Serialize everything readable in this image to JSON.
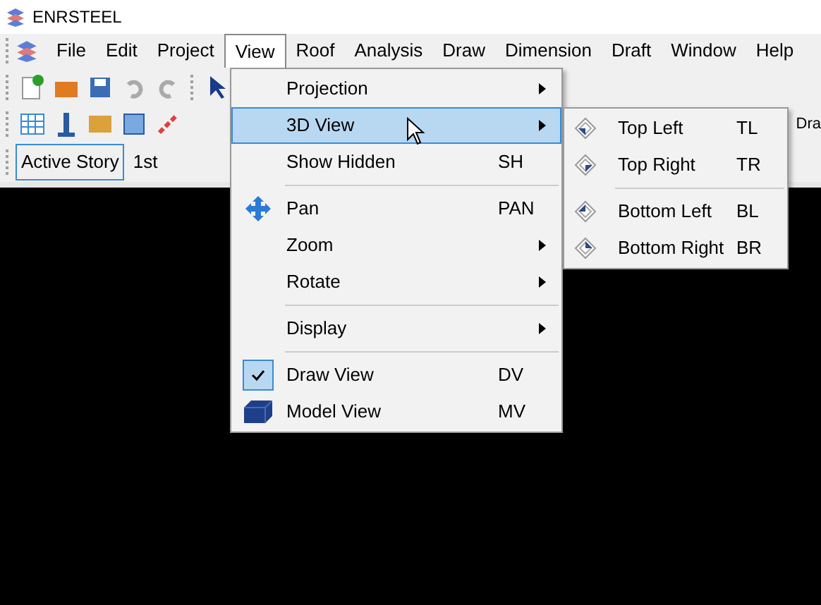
{
  "window": {
    "title": "ENRSTEEL"
  },
  "menubar": [
    {
      "label": "File",
      "selected": false
    },
    {
      "label": "Edit",
      "selected": false
    },
    {
      "label": "Project",
      "selected": false
    },
    {
      "label": "View",
      "selected": true
    },
    {
      "label": "Roof",
      "selected": false
    },
    {
      "label": "Analysis",
      "selected": false
    },
    {
      "label": "Draw",
      "selected": false
    },
    {
      "label": "Dimension",
      "selected": false
    },
    {
      "label": "Draft",
      "selected": false
    },
    {
      "label": "Window",
      "selected": false
    },
    {
      "label": "Help",
      "selected": false
    }
  ],
  "toolbar": {
    "cut_label": "Dra"
  },
  "story_bar": {
    "label": "Active Story",
    "value": "1st"
  },
  "view_menu": [
    {
      "kind": "item",
      "label": "Projection",
      "submenu": true,
      "selected": false
    },
    {
      "kind": "item",
      "label": "3D View",
      "submenu": true,
      "selected": true
    },
    {
      "kind": "item",
      "label": "Show Hidden",
      "shortcut": "SH",
      "selected": false
    },
    {
      "kind": "separator"
    },
    {
      "kind": "pan",
      "label": "Pan",
      "shortcut": "PAN",
      "selected": false
    },
    {
      "kind": "item",
      "label": "Zoom",
      "submenu": true,
      "selected": false
    },
    {
      "kind": "item",
      "label": "Rotate",
      "submenu": true,
      "selected": false
    },
    {
      "kind": "separator"
    },
    {
      "kind": "item",
      "label": "Display",
      "submenu": true,
      "selected": false
    },
    {
      "kind": "separator"
    },
    {
      "kind": "item",
      "label": "Draw View",
      "shortcut": "DV",
      "checked": true,
      "selected": false
    },
    {
      "kind": "model",
      "label": "Model View",
      "shortcut": "MV",
      "selected": false
    }
  ],
  "view_3d_submenu": [
    {
      "kind": "item",
      "label": "Top Left",
      "shortcut": "TL"
    },
    {
      "kind": "item",
      "label": "Top Right",
      "shortcut": "TR"
    },
    {
      "kind": "separator"
    },
    {
      "kind": "item",
      "label": "Bottom Left",
      "shortcut": "BL"
    },
    {
      "kind": "item",
      "label": "Bottom Right",
      "shortcut": "BR"
    }
  ]
}
